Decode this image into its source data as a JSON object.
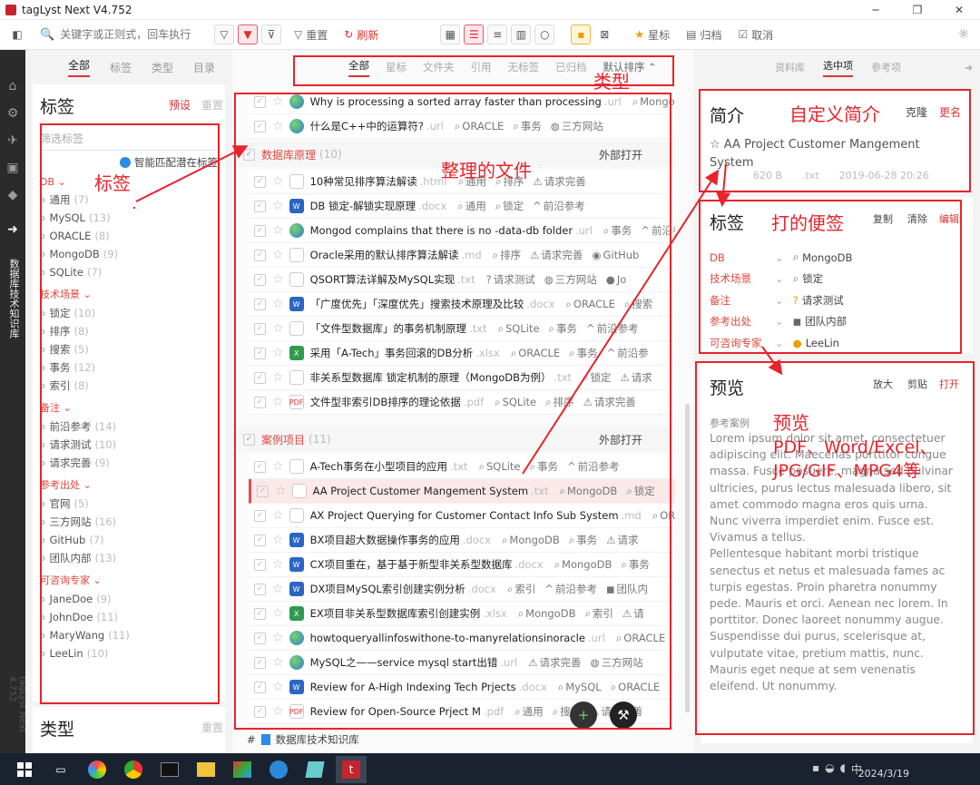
{
  "app": {
    "title": "tagLyst Next V4.752",
    "vertical_label": "数据库技术知识库",
    "version_label": "tagLyst Next 4.752"
  },
  "toolbar": {
    "search_placeholder": "关键字或正则式，回车执行",
    "reset": "重置",
    "refresh": "刷新",
    "star": "星标",
    "archive": "归档",
    "cancel": "取消"
  },
  "left": {
    "tabs": [
      "全部",
      "标签",
      "类型",
      "目录"
    ],
    "title": "标签",
    "preset": "预设",
    "reset": "重置",
    "filter_placeholder": "筛选标签",
    "smart_match": "智能匹配潜在标签",
    "groups": [
      {
        "name": "DB",
        "items": [
          {
            "label": "通用",
            "count": "(7)"
          },
          {
            "label": "MySQL",
            "count": "(13)"
          },
          {
            "label": "ORACLE",
            "count": "(8)"
          },
          {
            "label": "MongoDB",
            "count": "(9)"
          },
          {
            "label": "SQLite",
            "count": "(7)"
          }
        ]
      },
      {
        "name": "技术场景",
        "items": [
          {
            "label": "锁定",
            "count": "(10)"
          },
          {
            "label": "排序",
            "count": "(8)"
          },
          {
            "label": "搜索",
            "count": "(5)"
          },
          {
            "label": "事务",
            "count": "(12)"
          },
          {
            "label": "索引",
            "count": "(8)"
          }
        ]
      },
      {
        "name": "备注",
        "items": [
          {
            "label": "前沿参考",
            "count": "(14)"
          },
          {
            "label": "请求测试",
            "count": "(10)"
          },
          {
            "label": "请求完善",
            "count": "(9)"
          }
        ]
      },
      {
        "name": "参考出处",
        "items": [
          {
            "label": "官网",
            "count": "(5)"
          },
          {
            "label": "三方网站",
            "count": "(16)"
          },
          {
            "label": "GitHub",
            "count": "(7)"
          },
          {
            "label": "团队内部",
            "count": "(13)"
          }
        ]
      },
      {
        "name": "可咨询专家",
        "items": [
          {
            "label": "JaneDoe",
            "count": "(9)"
          },
          {
            "label": "JohnDoe",
            "count": "(11)"
          },
          {
            "label": "MaryWang",
            "count": "(11)"
          },
          {
            "label": "LeeLin",
            "count": "(10)"
          }
        ]
      }
    ],
    "type_title": "类型",
    "type_reset": "重置"
  },
  "middle": {
    "tabs": [
      "全部",
      "星标",
      "文件夹",
      "引用",
      "无标签",
      "已归档"
    ],
    "sort": "默认排序",
    "open_external": "外部打开",
    "rows_top": [
      {
        "name": "Why is processing a sorted array faster than processing",
        "ext": ".url",
        "icon": "url",
        "tags": [
          "MongoD"
        ]
      },
      {
        "name": "什么是C++中的运算符?",
        "ext": ".url",
        "icon": "url",
        "tags": [
          "ORACLE",
          "事务",
          "三方网站"
        ]
      }
    ],
    "group1": {
      "name": "数据库原理",
      "count": "(10)",
      "rows": [
        {
          "name": "10种常见排序算法解读",
          "ext": ".html",
          "icon": "html",
          "tags": [
            "通用",
            "排序",
            "请求完善"
          ]
        },
        {
          "name": "DB 锁定-解锁实现原理",
          "ext": ".docx",
          "icon": "doc",
          "tags": [
            "通用",
            "锁定",
            "前沿参考"
          ]
        },
        {
          "name": "Mongod complains that there is no -data-db folder",
          "ext": ".url",
          "icon": "url",
          "tags": [
            "事务",
            "前沿参考"
          ]
        },
        {
          "name": "Oracle采用的默认排序算法解读",
          "ext": ".md",
          "icon": "txt",
          "tags": [
            "排序",
            "请求完善",
            "GitHub"
          ]
        },
        {
          "name": "QSORT算法详解及MySQL实现",
          "ext": ".txt",
          "icon": "txt",
          "tags": [
            "请求测试",
            "三方网站",
            "Jo"
          ]
        },
        {
          "name": "「广度优先」「深度优先」搜索技术原理及比较",
          "ext": ".docx",
          "icon": "doc",
          "tags": [
            "ORACLE",
            "搜索"
          ]
        },
        {
          "name": "「文件型数据库」的事务机制原理",
          "ext": ".txt",
          "icon": "txt",
          "tags": [
            "SQLite",
            "事务",
            "前沿参考"
          ]
        },
        {
          "name": "采用「A-Tech」事务回滚的DB分析",
          "ext": ".xlsx",
          "icon": "xls",
          "tags": [
            "ORACLE",
            "事务",
            "前沿参"
          ]
        },
        {
          "name": "非关系型数据库 锁定机制的原理（MongoDB为例）",
          "ext": ".txt",
          "icon": "txt",
          "tags": [
            "锁定",
            "请求"
          ]
        },
        {
          "name": "文件型非索引DB排序的理论依据",
          "ext": ".pdf",
          "icon": "pdf",
          "tags": [
            "SQLite",
            "排序",
            "请求完善"
          ]
        }
      ]
    },
    "group2": {
      "name": "案例项目",
      "count": "(11)",
      "rows": [
        {
          "name": "A-Tech事务在小型项目的应用",
          "ext": ".txt",
          "icon": "txt",
          "tags": [
            "SQLite",
            "事务",
            "前沿参考"
          ]
        },
        {
          "name": "AA Project Customer Mangement System",
          "ext": ".txt",
          "icon": "txt",
          "tags": [
            "MongoDB",
            "锁定"
          ]
        },
        {
          "name": "AX Project Querying for Customer Contact Info Sub System",
          "ext": ".md",
          "icon": "txt",
          "tags": [
            "OR"
          ]
        },
        {
          "name": "BX项目超大数据操作事务的应用",
          "ext": ".docx",
          "icon": "doc",
          "tags": [
            "MongoDB",
            "事务",
            "请求"
          ]
        },
        {
          "name": "CX项目重在，基于基于新型非关系型数据库",
          "ext": ".docx",
          "icon": "doc",
          "tags": [
            "MongoDB",
            "事务"
          ]
        },
        {
          "name": "DX项目MySQL索引创建实例分析",
          "ext": ".docx",
          "icon": "doc",
          "tags": [
            "索引",
            "前沿参考",
            "团队内"
          ]
        },
        {
          "name": "EX项目非关系型数据库索引创建实例",
          "ext": ".xlsx",
          "icon": "xls",
          "tags": [
            "MongoDB",
            "索引",
            "请"
          ]
        },
        {
          "name": "howtoqueryallinfoswithone-to-manyrelationsinoracle",
          "ext": ".url",
          "icon": "url",
          "tags": [
            "ORACLE"
          ]
        },
        {
          "name": "MySQL之——service mysql start出错",
          "ext": ".url",
          "icon": "url",
          "tags": [
            "请求完善",
            "三方网站"
          ]
        },
        {
          "name": "Review for A-High Indexing Tech Prjects",
          "ext": ".docx",
          "icon": "doc",
          "tags": [
            "MySQL",
            "ORACLE"
          ]
        },
        {
          "name": "Review for Open-Source Prject M",
          "ext": ".pdf",
          "icon": "pdf",
          "tags": [
            "通用",
            "搜索",
            "请求完善"
          ]
        }
      ]
    },
    "footer": "数据库技术知识库"
  },
  "right": {
    "tabs": [
      "资料库",
      "选中项",
      "参考项"
    ],
    "intro": {
      "title": "简介",
      "clone": "克隆",
      "rename": "更名",
      "name": "AA Project Customer Mangement System",
      "size": "620 B",
      "ext": ".txt",
      "date": "2019-06-28 20:26"
    },
    "tags": {
      "title": "标签",
      "copy": "复制",
      "clear": "清除",
      "edit": "编辑",
      "rows": [
        {
          "group": "DB",
          "value": "MongoDB",
          "icon": "tag"
        },
        {
          "group": "技术场景",
          "value": "锁定",
          "icon": "tag"
        },
        {
          "group": "备注",
          "value": "请求测试",
          "icon": "test"
        },
        {
          "group": "参考出处",
          "value": "团队内部",
          "icon": "team"
        },
        {
          "group": "可咨询专家",
          "value": "LeeLin",
          "icon": "person"
        }
      ]
    },
    "preview": {
      "title": "预览",
      "zoom": "放大",
      "clip": "剪贴",
      "open": "打开",
      "heading": "参考案例",
      "text": [
        "Lorem ipsum dolor sit amet, consectetuer adipiscing elit. Maecenas porttitor congue massa. Fusce posuere, magna sed pulvinar ultricies, purus lectus malesuada libero, sit amet commodo magna eros quis urna.",
        "Nunc viverra imperdiet enim. Fusce est. Vivamus a tellus.",
        "Pellentesque habitant morbi tristique senectus et netus et malesuada fames ac turpis egestas. Proin pharetra nonummy pede. Mauris et orci. Aenean nec lorem. In porttitor. Donec laoreet nonummy augue.",
        "Suspendisse dui purus, scelerisque at, vulputate vitae, pretium mattis, nunc. Mauris eget neque at sem venenatis eleifend. Ut nonummy."
      ]
    }
  },
  "annotations": {
    "tags": "标签",
    "type": "类型",
    "files": "整理的文件",
    "intro": "自定义简介",
    "sticky": "打的便签",
    "preview": "预览",
    "formats": "PDF、Word/Excel、JPG/GIF、MPG4等"
  },
  "taskbar": {
    "date": "2024/3/19"
  }
}
